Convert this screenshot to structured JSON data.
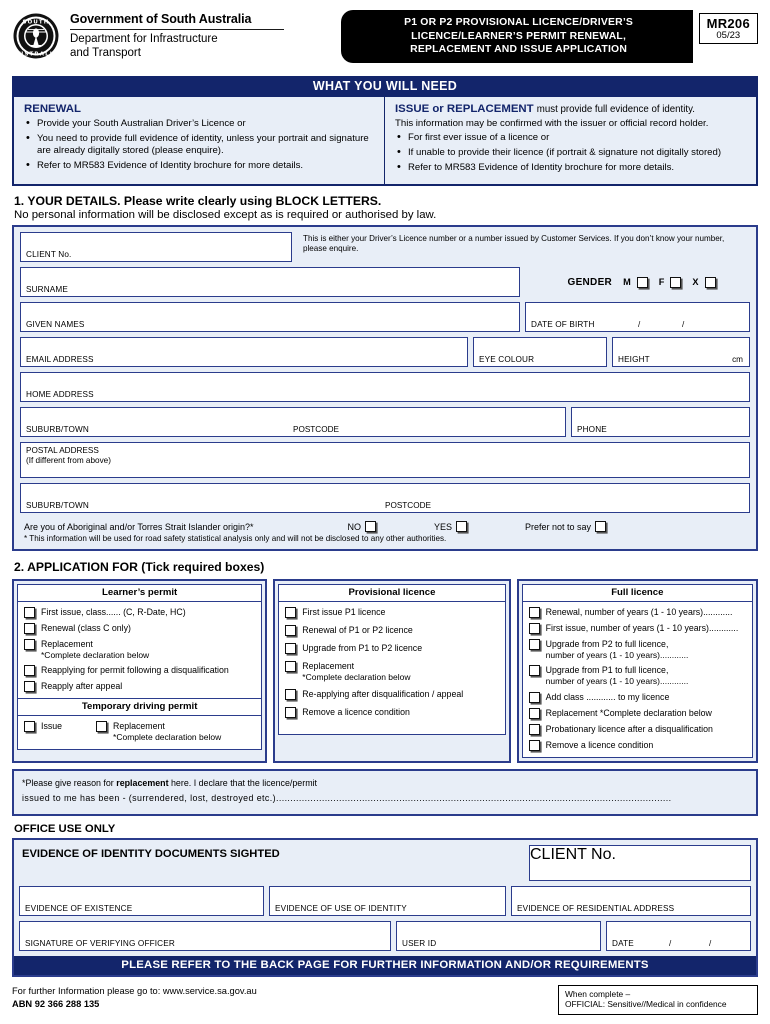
{
  "masthead": {
    "crest_alt": "south-australia-crest",
    "gov_title": "Government of South Australia",
    "dept_line1": "Department for Infrastructure",
    "dept_line2": "and Transport",
    "form_title_line1": "P1 OR P2 PROVISIONAL LICENCE/DRIVER’S",
    "form_title_line2": "LICENCE/LEARNER’S PERMIT RENEWAL,",
    "form_title_line3": "REPLACEMENT AND ISSUE APPLICATION",
    "form_code": "MR206",
    "form_date": "05/23"
  },
  "what_you_need": {
    "band_title": "WHAT YOU WILL NEED",
    "renewal": {
      "heading": "RENEWAL",
      "bullets": [
        "Provide your South Australian Driver’s Licence or",
        "You need to provide full evidence of identity, unless your portrait and signature are already digitally stored (please enquire).",
        "Refer to MR583 Evidence of Identity brochure for more details."
      ]
    },
    "issue": {
      "heading": "ISSUE or REPLACEMENT",
      "heading_light": "must provide full evidence of identity.",
      "subtext": "This information may be confirmed with the issuer or official record holder.",
      "bullets": [
        "For first ever issue of a licence or",
        "If unable to provide their licence (if portrait & signature not digitally stored)",
        "Refer to MR583 Evidence of Identity brochure for more details."
      ]
    }
  },
  "section1": {
    "title": "1. YOUR DETAILS. Please write clearly using BLOCK LETTERS.",
    "subtitle": "No personal information will be disclosed except as is required or authorised by law.",
    "client_no_label": "CLIENT No.",
    "client_note": "This is either your Driver’s Licence number or a number issued by Customer Services. If you don’t know your number, please enquire.",
    "surname_label": "SURNAME",
    "gender_label": "GENDER",
    "gender_options": [
      "M",
      "F",
      "X"
    ],
    "given_names_label": "GIVEN NAMES",
    "dob_label": "DATE OF BIRTH",
    "dob_slash1": "/",
    "dob_slash2": "/",
    "email_label": "EMAIL ADDRESS",
    "eye_colour_label": "EYE COLOUR",
    "height_label": "HEIGHT",
    "height_unit": "cm",
    "home_address_label": "HOME ADDRESS",
    "suburb_label": "SUBURB/TOWN",
    "postcode_label": "POSTCODE",
    "phone_label": "PHONE",
    "postal_label_line1": "POSTAL ADDRESS",
    "postal_label_line2": "(If different from above)",
    "postal_suburb_label": "SUBURB/TOWN",
    "postal_postcode_label": "POSTCODE",
    "atsi_question": "Are you of Aboriginal and/or Torres Strait Islander origin?*",
    "atsi_options": [
      "NO",
      "YES",
      "Prefer not to say"
    ],
    "atsi_note": "* This information will be used for road safety statistical analysis only and will not be disclosed to any other authorities."
  },
  "section2": {
    "title": "2. APPLICATION FOR (Tick required boxes)",
    "columns": [
      {
        "heading": "Learner’s permit",
        "items": [
          {
            "text": "First issue, class...... (C, R-Date, HC)",
            "sub": ""
          },
          {
            "text": "Renewal (class C only)",
            "sub": ""
          },
          {
            "text": "Replacement",
            "sub": "*Complete declaration below"
          },
          {
            "text": "Reapplying for permit following a disqualification",
            "sub": ""
          },
          {
            "text": "Reapply after appeal",
            "sub": ""
          }
        ],
        "sub_heading": "Temporary driving permit",
        "sub_items": [
          {
            "text": "Issue",
            "sub": ""
          },
          {
            "text": "Replacement",
            "sub": "*Complete declaration below"
          }
        ]
      },
      {
        "heading": "Provisional licence",
        "items": [
          {
            "text": "First issue P1 licence",
            "sub": ""
          },
          {
            "text": "Renewal of P1 or P2 licence",
            "sub": ""
          },
          {
            "text": "Upgrade from P1 to P2 licence",
            "sub": ""
          },
          {
            "text": "Replacement",
            "sub": "*Complete declaration below"
          },
          {
            "text": "Re-applying after disqualification / appeal",
            "sub": ""
          },
          {
            "text": "Remove a licence condition",
            "sub": ""
          }
        ]
      },
      {
        "heading": "Full licence",
        "items": [
          {
            "text": "Renewal, number of years (1 - 10 years)............",
            "sub": ""
          },
          {
            "text": "First issue, number of years (1 - 10 years)............",
            "sub": ""
          },
          {
            "text": "Upgrade from P2 to full licence,",
            "sub": "number of years (1 - 10 years)............"
          },
          {
            "text": "Upgrade from P1 to full licence,",
            "sub": "number of years (1 - 10 years)............"
          },
          {
            "text": "Add class ............ to my licence",
            "sub": ""
          },
          {
            "text": "Replacement *Complete declaration below",
            "sub": ""
          },
          {
            "text": "Probationary licence after a disqualification",
            "sub": ""
          },
          {
            "text": "Remove a licence condition",
            "sub": ""
          }
        ]
      }
    ]
  },
  "declaration": {
    "line1_a": "*Please give reason for ",
    "line1_b": "replacement",
    "line1_c": " here. I declare that the licence/permit",
    "line2": "issued to me has been - (surrendered, lost, destroyed etc.).........................................................................................................................................."
  },
  "office_use": {
    "heading": "OFFICE USE ONLY",
    "evidence_title": "EVIDENCE OF IDENTITY DOCUMENTS SIGHTED",
    "client_no_label": "CLIENT No.",
    "evidence_existence": "EVIDENCE OF EXISTENCE",
    "evidence_use_identity": "EVIDENCE OF USE OF IDENTITY",
    "evidence_residential": "EVIDENCE OF RESIDENTIAL ADDRESS",
    "signature_label": "SIGNATURE OF VERIFYING OFFICER",
    "user_id_label": "USER ID",
    "date_label": "DATE",
    "date_slash1": "/",
    "date_slash2": "/",
    "back_page_bar": "PLEASE REFER TO THE BACK PAGE FOR FURTHER INFORMATION AND/OR REQUIREMENTS"
  },
  "footer": {
    "info_line": "For further Information please go to: www.service.sa.gov.au",
    "abn_line": "ABN 92 366 288 135",
    "when_complete_line1": "When complete –",
    "when_complete_line2": "OFFICIAL: Sensitive//Medical in confidence"
  },
  "colors": {
    "brand_navy": "#13256b",
    "field_border": "#2b3c8c",
    "panel_bg": "#e8eef7",
    "header_black": "#000000"
  }
}
